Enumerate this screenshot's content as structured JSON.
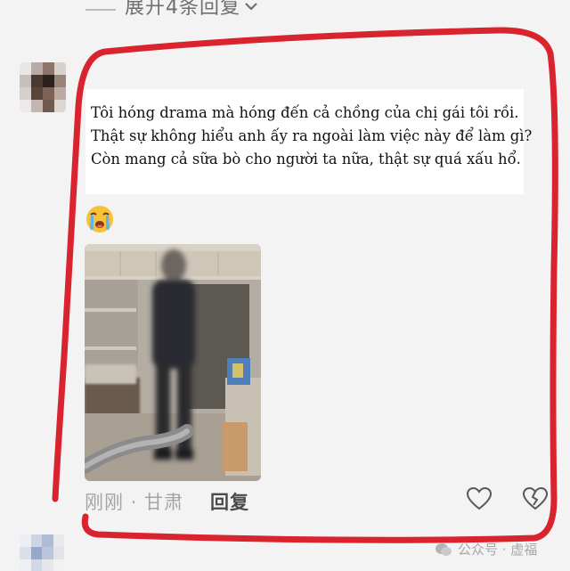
{
  "comment_thread": {
    "expand_replies_label": "展开4条回复",
    "expand_chevron": "chevron-down-icon"
  },
  "comment": {
    "avatar_icon": "avatar",
    "overlay_text": {
      "lines": [
        "Tôi hóng drama mà hóng đến cả chồng của chị gái tôi rồi.",
        "Thật sự không hiểu anh ấy ra ngoài làm việc này để làm gì?",
        "Còn mang cả sữa bò cho người ta nữa, thật sự quá xấu hổ."
      ]
    },
    "emoji": "loudly-crying-face-icon",
    "photo": "blurred-man-in-room-photo",
    "time_location": "刚刚 · 甘肃",
    "reply_label": "回复",
    "like_icon": "heart-icon",
    "dislike_icon": "broken-heart-icon"
  },
  "annotation": {
    "outline_color": "#d9232e"
  },
  "watermark": {
    "text": "公众号 · 虚福"
  },
  "colors": {
    "background": "#f3f3f4",
    "muted_text": "#a4a4a8",
    "reply_text": "#4a4a4e"
  }
}
